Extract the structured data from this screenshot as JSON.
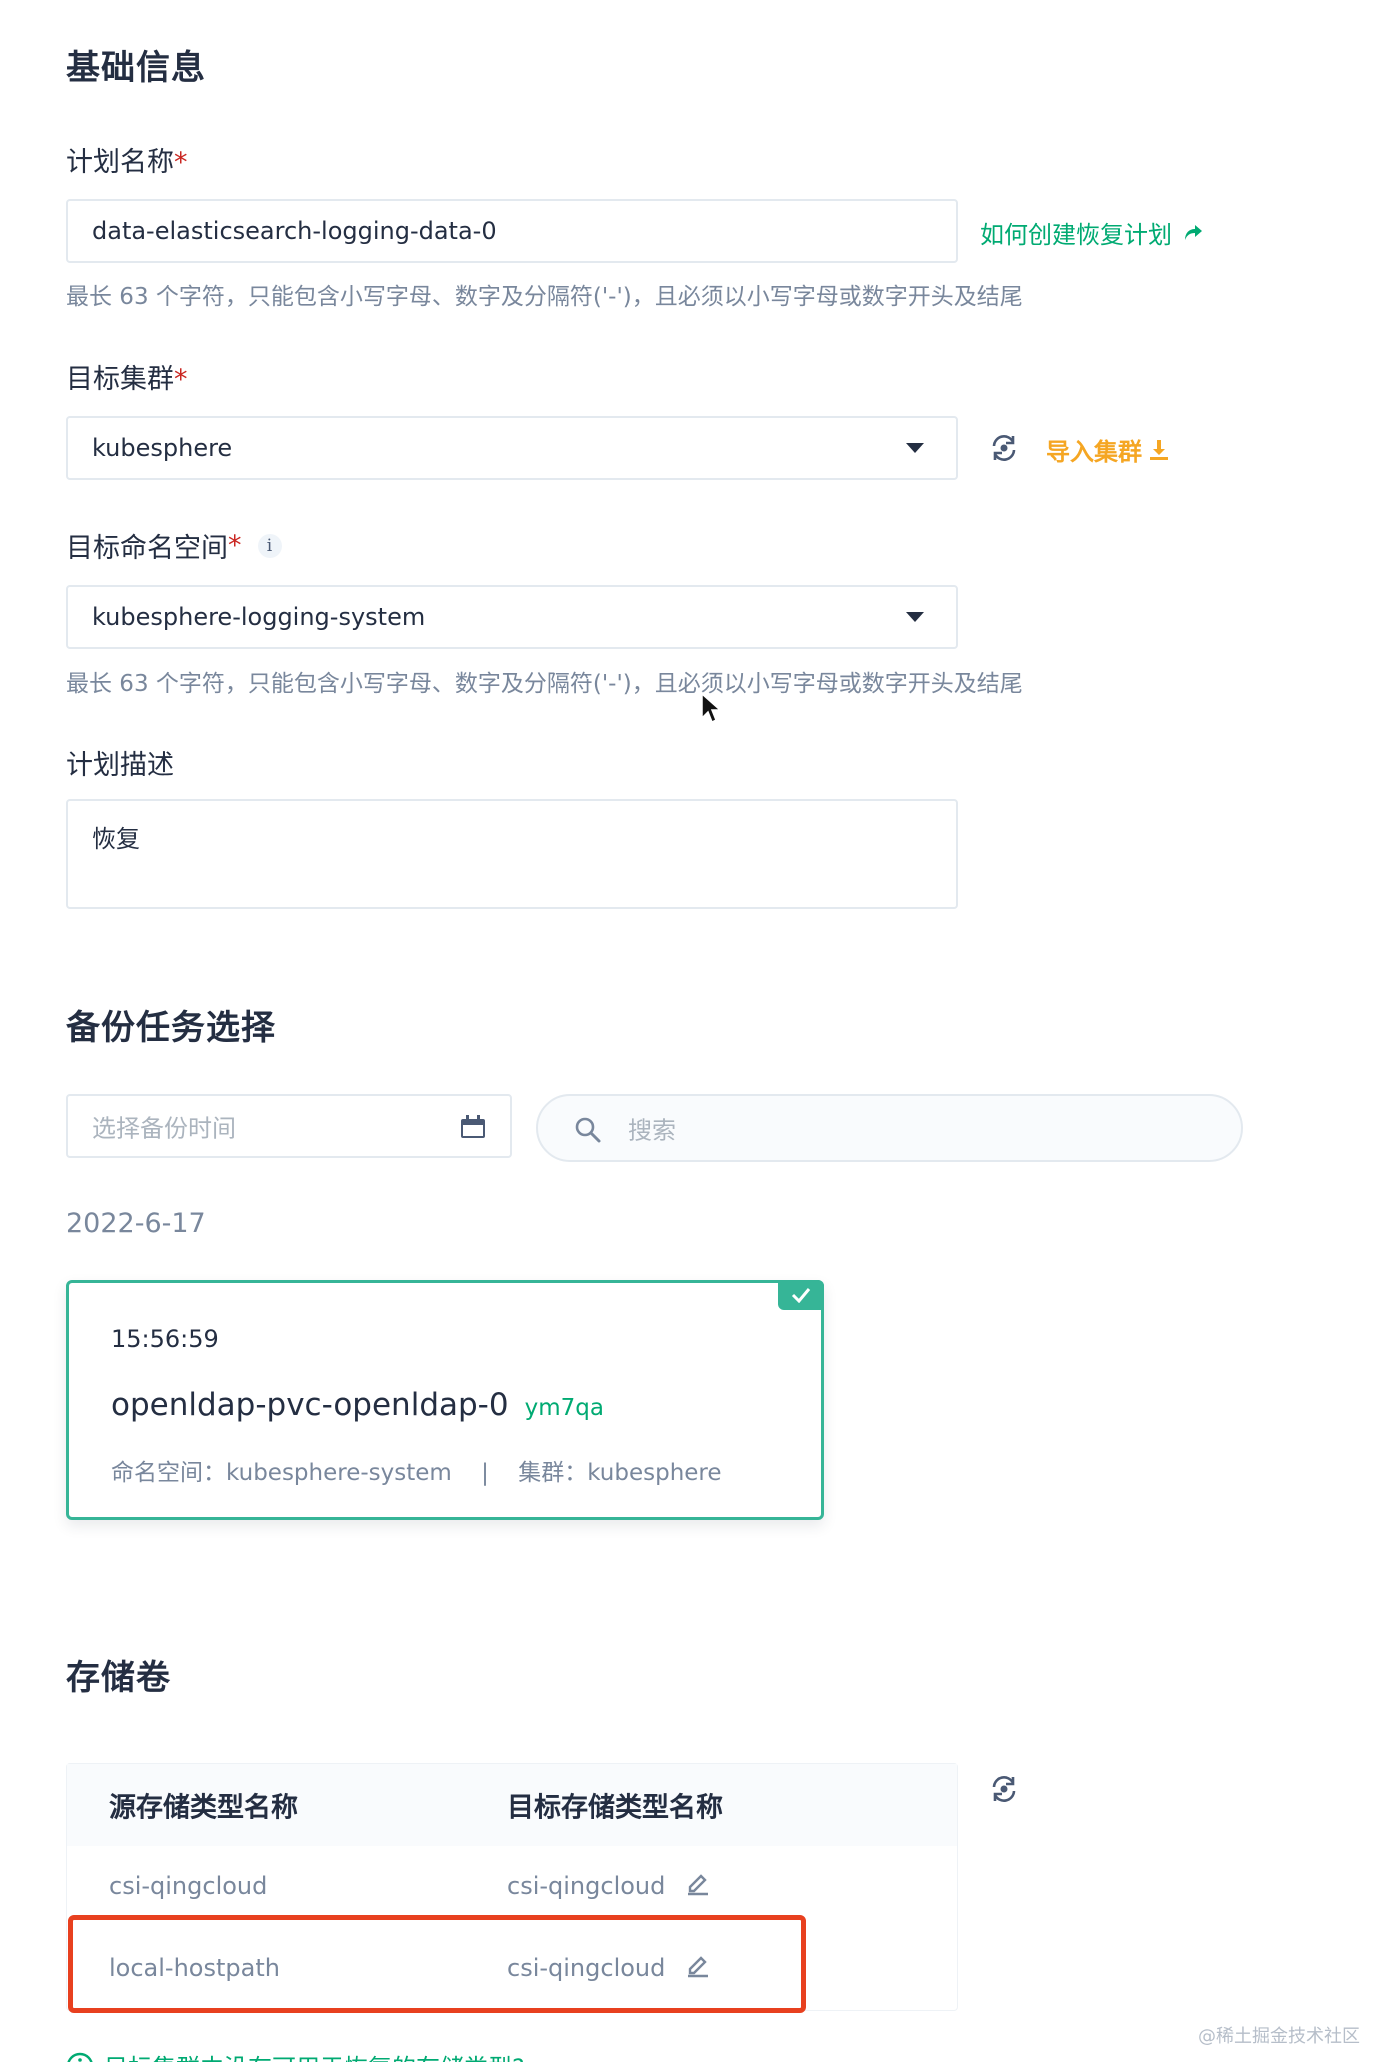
{
  "basic_info": {
    "title": "基础信息",
    "plan_name": {
      "label": "计划名称",
      "required_mark": "*",
      "value": "data-elasticsearch-logging-data-0",
      "help_link": "如何创建恢复计划",
      "hint": "最长 63 个字符，只能包含小写字母、数字及分隔符('-')，且必须以小写字母或数字开头及结尾"
    },
    "target_cluster": {
      "label": "目标集群",
      "required_mark": "*",
      "value": "kubesphere",
      "import_link": "导入集群"
    },
    "target_namespace": {
      "label": "目标命名空间",
      "required_mark": "*",
      "info_glyph": "i",
      "value": "kubesphere-logging-system",
      "hint": "最长 63 个字符，只能包含小写字母、数字及分隔符('-')，且必须以小写字母或数字开头及结尾"
    },
    "description": {
      "label": "计划描述",
      "value": "恢复"
    }
  },
  "backup_selection": {
    "title": "备份任务选择",
    "date_picker_placeholder": "选择备份时间",
    "search_placeholder": "搜索",
    "date_group": "2022-6-17",
    "card": {
      "time": "15:56:59",
      "name": "openldap-pvc-openldap-0",
      "suffix": "ym7qa",
      "namespace_label": "命名空间：",
      "namespace_value": "kubesphere-system",
      "separator": "|",
      "cluster_label": "集群：",
      "cluster_value": "kubesphere",
      "selected": true
    }
  },
  "storage": {
    "title": "存储卷",
    "columns": [
      "源存储类型名称",
      "目标存储类型名称"
    ],
    "rows": [
      {
        "source": "csi-qingcloud",
        "target": "csi-qingcloud"
      },
      {
        "source": "local-hostpath",
        "target": "csi-qingcloud"
      }
    ],
    "highlight_color": "#e8401f",
    "footer_link": "目标集群中没有可用于恢复的存储类型?"
  },
  "watermark": "@稀土掘金技术社区",
  "colors": {
    "accent_green": "#00aa72",
    "card_border": "#36b597",
    "import_orange": "#f5a623",
    "required_red": "#ca2621"
  }
}
